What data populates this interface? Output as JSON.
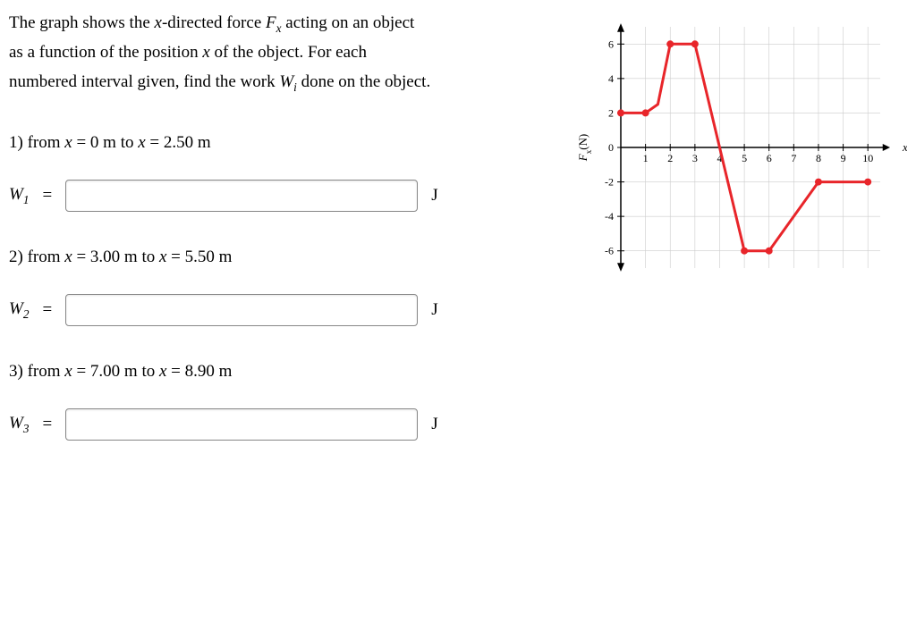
{
  "prompt": {
    "line1": "The graph shows the x-directed force Fₓ acting on an object",
    "line2": "as a function of the position x of the object. For each",
    "line3": "numbered interval given, find the work Wᵢ done on the object."
  },
  "questions": [
    {
      "num": "1)",
      "from": "0 m",
      "to": "2.50 m",
      "var": "W₁",
      "unit": "J"
    },
    {
      "num": "2)",
      "from": "3.00 m",
      "to": "5.50 m",
      "var": "W₂",
      "unit": "J"
    },
    {
      "num": "3)",
      "from": "7.00 m",
      "to": "8.90 m",
      "var": "W₃",
      "unit": "J"
    }
  ],
  "chart_data": {
    "type": "line",
    "xlabel": "x(m)",
    "ylabel": "Fₓ(N)",
    "xlim": [
      0,
      10.5
    ],
    "ylim": [
      -7,
      7
    ],
    "xticks": [
      1,
      2,
      3,
      4,
      5,
      6,
      7,
      8,
      9,
      10
    ],
    "yticks": [
      -6,
      -4,
      -2,
      0,
      2,
      4,
      6
    ],
    "series": [
      {
        "name": "Fx",
        "color": "#e8252a",
        "x": [
          0,
          1,
          1.5,
          2,
          3,
          4,
          5,
          6,
          7,
          8,
          10
        ],
        "y": [
          2,
          2,
          2.5,
          6,
          6,
          0,
          -6,
          -6,
          -4,
          -2,
          -2
        ]
      }
    ],
    "markers_x": [
      0,
      1,
      2,
      3,
      5,
      6,
      8,
      10
    ]
  },
  "inputs": {
    "W1": "",
    "W2": "",
    "W3": ""
  }
}
